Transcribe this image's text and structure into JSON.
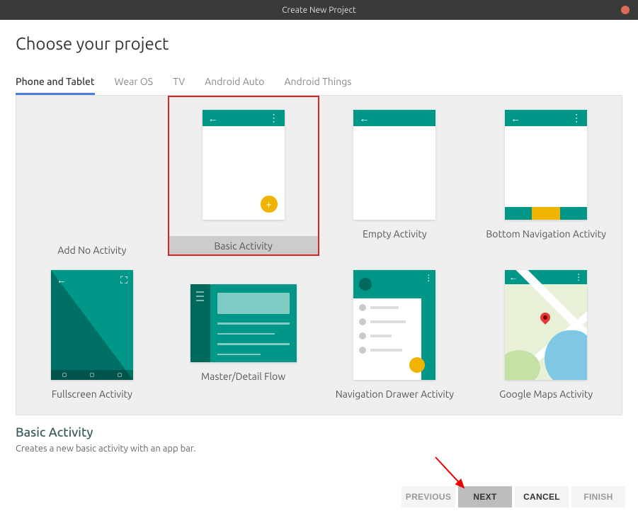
{
  "window": {
    "title": "Create New Project"
  },
  "header": {
    "title": "Choose your project"
  },
  "tabs": [
    "Phone and Tablet",
    "Wear OS",
    "TV",
    "Android Auto",
    "Android Things"
  ],
  "templates": {
    "row1": [
      {
        "label": "Add No Activity"
      },
      {
        "label": "Basic Activity",
        "selected": true
      },
      {
        "label": "Empty Activity"
      },
      {
        "label": "Bottom Navigation Activity"
      }
    ],
    "row2": [
      {
        "label": "Fullscreen Activity"
      },
      {
        "label": "Master/Detail Flow"
      },
      {
        "label": "Navigation Drawer Activity"
      },
      {
        "label": "Google Maps Activity"
      }
    ]
  },
  "selection": {
    "title": "Basic Activity",
    "description": "Creates a new basic activity with an app bar."
  },
  "footer": {
    "previous": "PREVIOUS",
    "next": "NEXT",
    "cancel": "CANCEL",
    "finish": "FINISH"
  }
}
